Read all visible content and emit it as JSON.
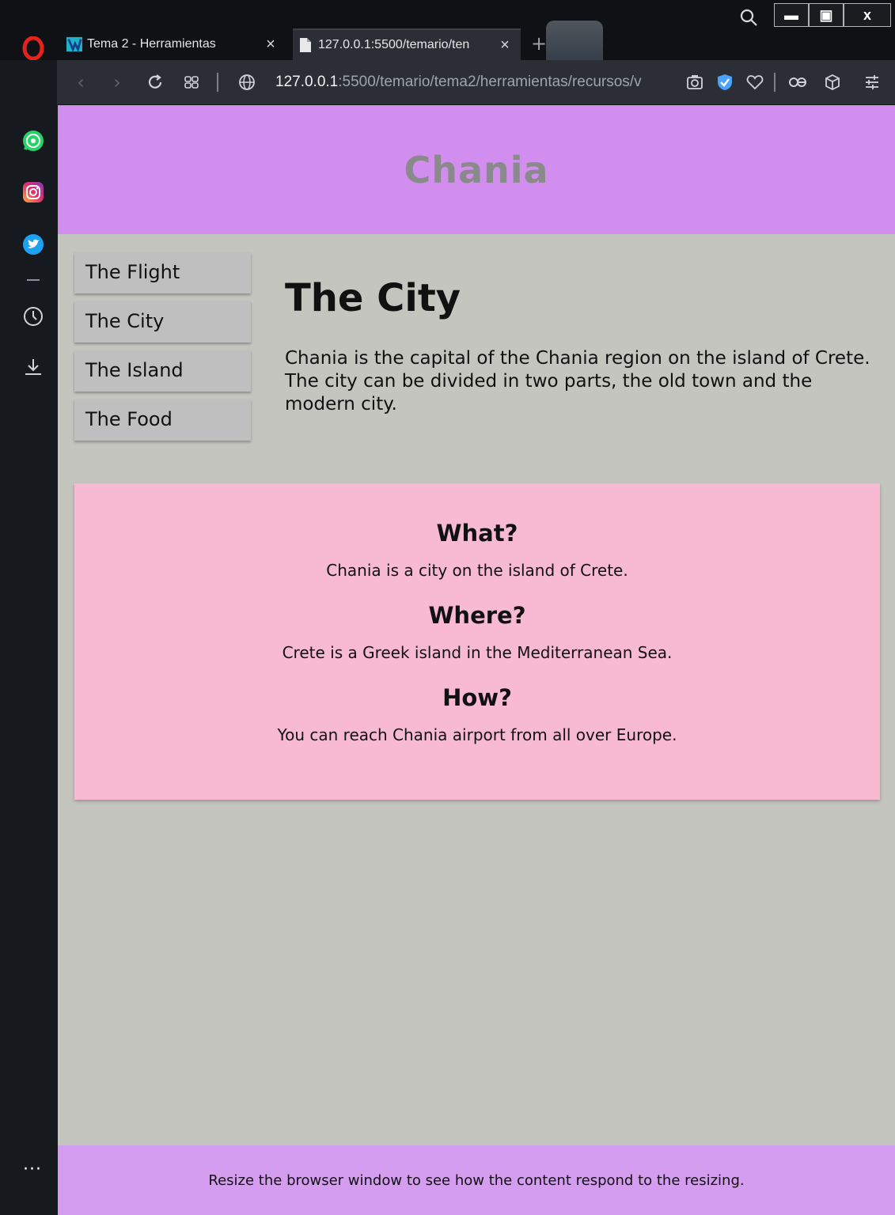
{
  "browser": {
    "tabs": [
      {
        "title": "Tema 2 - Herramientas",
        "close": "×"
      },
      {
        "title": "127.0.0.1:5500/temario/ten",
        "close": "×"
      }
    ],
    "newtab": "+",
    "url_host": "127.0.0.1",
    "url_rest": ":5500/temario/tema2/herramientas/recursos/v",
    "window_controls": {
      "minimize": "▬",
      "maximize": "▣",
      "close": "x"
    },
    "sidebar_more": "···"
  },
  "page": {
    "header_title": "Chania",
    "menu": [
      "The Flight",
      "The City",
      "The Island",
      "The Food"
    ],
    "main": {
      "heading": "The City",
      "body": "Chania is the capital of the Chania region on the island of Crete. The city can be divided in two parts, the old town and the modern city."
    },
    "aside": [
      {
        "q": "What?",
        "a": "Chania is a city on the island of Crete."
      },
      {
        "q": "Where?",
        "a": "Crete is a Greek island in the Mediterranean Sea."
      },
      {
        "q": "How?",
        "a": "You can reach Chania airport from all over Europe."
      }
    ],
    "footer": "Resize the browser window to see how the content respond to the resizing."
  },
  "colors": {
    "header": "#d18eef",
    "page_bg": "#c4c5bf",
    "aside_bg": "#f8b9d2",
    "footer": "#d49df0",
    "menu_item": "#bfbfbf"
  },
  "icons": {
    "sidebar": [
      "whatsapp-icon",
      "instagram-icon",
      "twitter-icon",
      "history-icon",
      "downloads-icon"
    ],
    "toolbar": [
      "back-icon",
      "forward-icon",
      "reload-icon",
      "speed-dial-icon",
      "globe-icon",
      "snapshot-icon",
      "vpn-shield-icon",
      "heart-icon",
      "aria-icon",
      "cube-icon",
      "easy-setup-icon"
    ]
  }
}
